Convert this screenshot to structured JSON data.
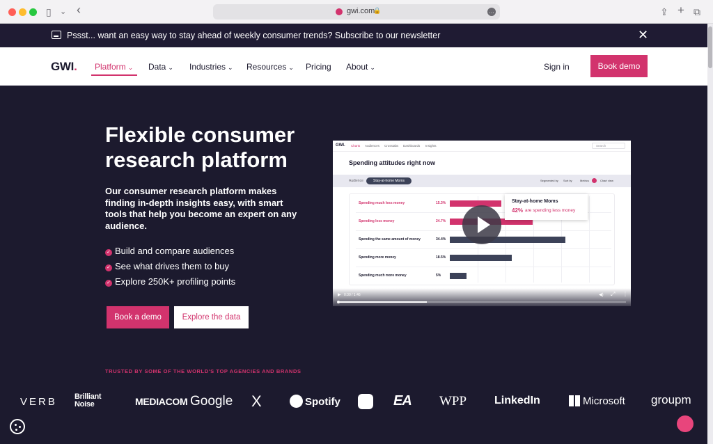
{
  "browser": {
    "url": "gwi.com",
    "lock_icon": "🔒",
    "sidebar_icon": "▯",
    "chevron_icon": "⌄",
    "back_icon": "‹",
    "share_icon": "⇪",
    "newtab_icon": "+",
    "tabs_icon": "⧉",
    "more_icon": "•••"
  },
  "announcement": {
    "text": "Pssst... want an easy way to stay ahead of weekly consumer trends? Subscribe to our newsletter",
    "close": "✕"
  },
  "nav": {
    "logo": "GWI",
    "logo_dot": ".",
    "items": [
      {
        "label": "Platform"
      },
      {
        "label": "Data"
      },
      {
        "label": "Industries"
      },
      {
        "label": "Resources"
      },
      {
        "label": "Pricing"
      },
      {
        "label": "About"
      }
    ],
    "chevron": "⌄",
    "signin": "Sign in",
    "demo": "Book demo"
  },
  "hero": {
    "title": "Flexible consumer research platform",
    "subtitle": "Our consumer research platform makes finding in-depth insights easy, with smart tools that help you become an expert on any audience.",
    "bullets": [
      "Build and compare audiences",
      "See what drives them to buy",
      "Explore 250K+ profiling points"
    ],
    "check": "✓",
    "btn_primary": "Book a demo",
    "btn_secondary": "Explore the data"
  },
  "video": {
    "logo": "GWI.",
    "tabs": [
      "Charts",
      "Audiences",
      "Crosstabs",
      "Dashboards",
      "Insights"
    ],
    "search": "Search",
    "title": "Spending attitudes right now",
    "audience_label": "Audience",
    "audience_pill": "Stay-at-home Moms",
    "controls": [
      "Segmented by",
      "Sort by",
      "Metrics",
      "Chart view"
    ],
    "rows": [
      {
        "label": "Spending much less money",
        "value": "15.3%",
        "pct": 15.3,
        "highlight": true
      },
      {
        "label": "Spending less money",
        "value": "24.7%",
        "pct": 24.7,
        "highlight": true
      },
      {
        "label": "Spending the same amount of money",
        "value": "34.4%",
        "pct": 34.4,
        "highlight": false
      },
      {
        "label": "Spending more money",
        "value": "18.5%",
        "pct": 18.5,
        "highlight": false
      },
      {
        "label": "Spending much more money",
        "value": "5%",
        "pct": 5,
        "highlight": false
      }
    ],
    "tooltip_title": "Stay-at-home Moms",
    "tooltip_pct": "42%",
    "tooltip_rest": "are spending less money",
    "time": "0:30 / 1:46",
    "progress": 0.31,
    "play_icon": "▶",
    "volume_icon": "◀)",
    "fullscreen_icon": "⤢",
    "menu_icon": "⋮",
    "colors": {
      "highlight": "#d2336d",
      "normal": "#3c4258"
    }
  },
  "trusted": {
    "label": "TRUSTED BY SOME OF THE WORLD'S TOP AGENCIES AND BRANDS",
    "brands": [
      "VERB",
      "Brilliant Noise",
      "MEDIACOM",
      "Google",
      "X",
      "Spotify",
      "Snapchat",
      "EA",
      "WPP",
      "LinkedIn",
      "Microsoft",
      "groupm"
    ]
  },
  "colors": {
    "brand": "#d2336d",
    "background": "#1c1a2e",
    "navy": "#3c4258"
  }
}
